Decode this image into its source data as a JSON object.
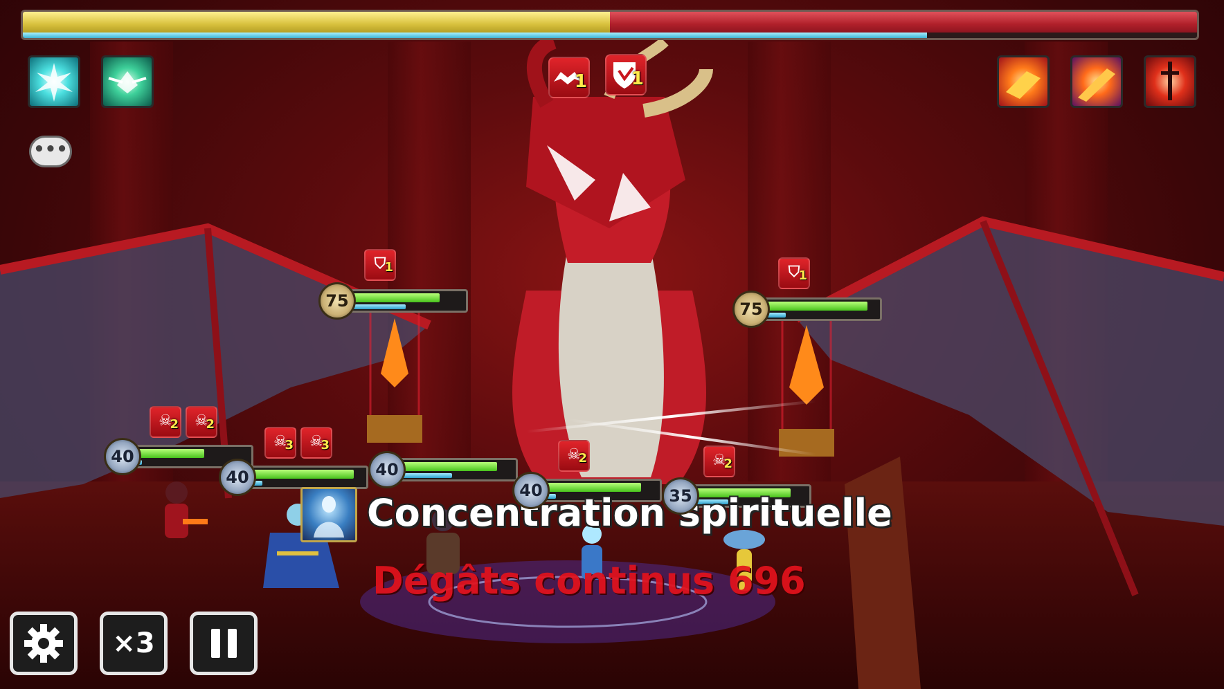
{
  "boss": {
    "hp_ratio": 0.5,
    "atb_ratio": 0.77
  },
  "status_icons": {
    "left": [
      "lightning-burst-icon",
      "winged-emblem-icon"
    ],
    "right": [
      "dragon-breath-icon",
      "dragon-strike-icon",
      "sword-pierce-icon"
    ]
  },
  "boss_debuffs": [
    {
      "icon": "bat-debuff-icon",
      "count": "1"
    },
    {
      "icon": "broken-shield-icon",
      "count": "1"
    }
  ],
  "enemies": [
    {
      "level": "75",
      "hp": 0.78,
      "atb": 0.48,
      "debuff_count": "1"
    },
    {
      "level": "75",
      "hp": 0.9,
      "atb": 0.18,
      "debuff_count": "1"
    }
  ],
  "allies": [
    {
      "level": "40",
      "hp": 0.6,
      "atb": 0.05,
      "debuffs": [
        "2",
        "2"
      ]
    },
    {
      "level": "40",
      "hp": 0.9,
      "atb": 0.1,
      "debuffs": [
        "3",
        "3"
      ]
    },
    {
      "level": "40",
      "hp": 0.85,
      "atb": 0.45,
      "debuffs": []
    },
    {
      "level": "40",
      "hp": 0.85,
      "atb": 0.1,
      "debuffs": [
        "2"
      ]
    },
    {
      "level": "35",
      "hp": 0.85,
      "atb": 0.3,
      "debuffs": [
        "2"
      ]
    }
  ],
  "combat_text": {
    "skill_name": "Concentration spirituelle",
    "damage_text": "Dégâts continus 696"
  },
  "controls": {
    "settings_icon": "gear-icon",
    "speed_label": "×3",
    "pause_icon": "pause-icon"
  },
  "chat_label": "•••",
  "colors": {
    "boss_hp": "#d8c13e",
    "boss_hp_lost": "#b0202a",
    "debuff_bg": "#c8161e",
    "damage_text": "#e3121c"
  }
}
